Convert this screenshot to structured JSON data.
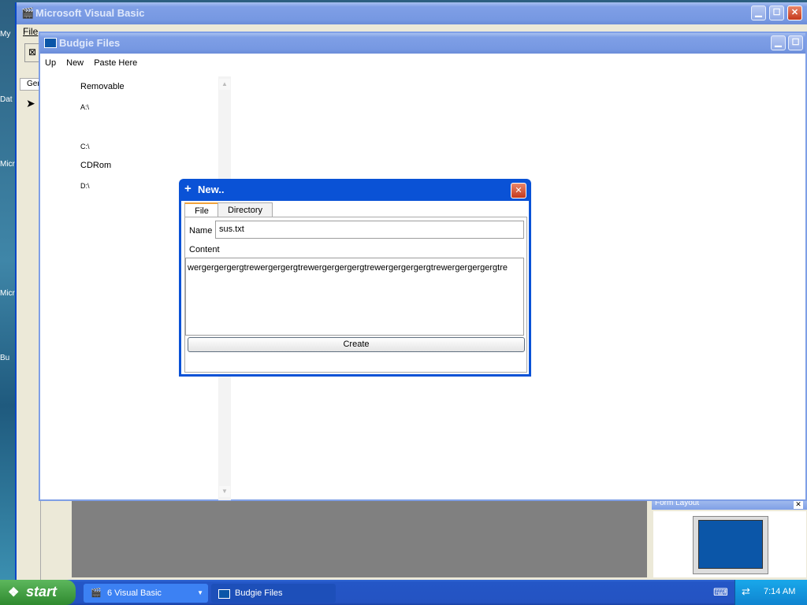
{
  "vb": {
    "title": "Microsoft Visual Basic",
    "menu_file": "File",
    "tab_general_partial": "Ger",
    "form_layout_title": "Form Layout"
  },
  "desktop_labels": [
    "My",
    "Dat",
    "Micr",
    "Micr",
    "Bu"
  ],
  "budgie": {
    "title": "Budgie Files",
    "menu": [
      "Up",
      "New",
      "Paste Here"
    ],
    "drives": [
      {
        "label": "Removable"
      },
      {
        "label": "A:\\"
      },
      {
        "label": "C:\\"
      },
      {
        "label": "CDRom"
      },
      {
        "label": "D:\\"
      }
    ]
  },
  "dialog": {
    "title": "New..",
    "tabs": [
      "File",
      "Directory"
    ],
    "active_tab": "File",
    "name_label": "Name",
    "name_value": "sus.txt",
    "content_label": "Content",
    "content_value": "wergergergergtrewergergergtrewergergergergtrewergergergergtrewergergergergtre",
    "create_label": "Create"
  },
  "taskbar": {
    "start_label": "start",
    "tasks": [
      {
        "label": "6 Visual Basic"
      },
      {
        "label": "Budgie Files"
      }
    ],
    "clock": "7:14 AM"
  },
  "colors": {
    "xp_blue": "#0554d8",
    "start_green": "#3c963c",
    "tab_accent": "#f1a33c"
  }
}
